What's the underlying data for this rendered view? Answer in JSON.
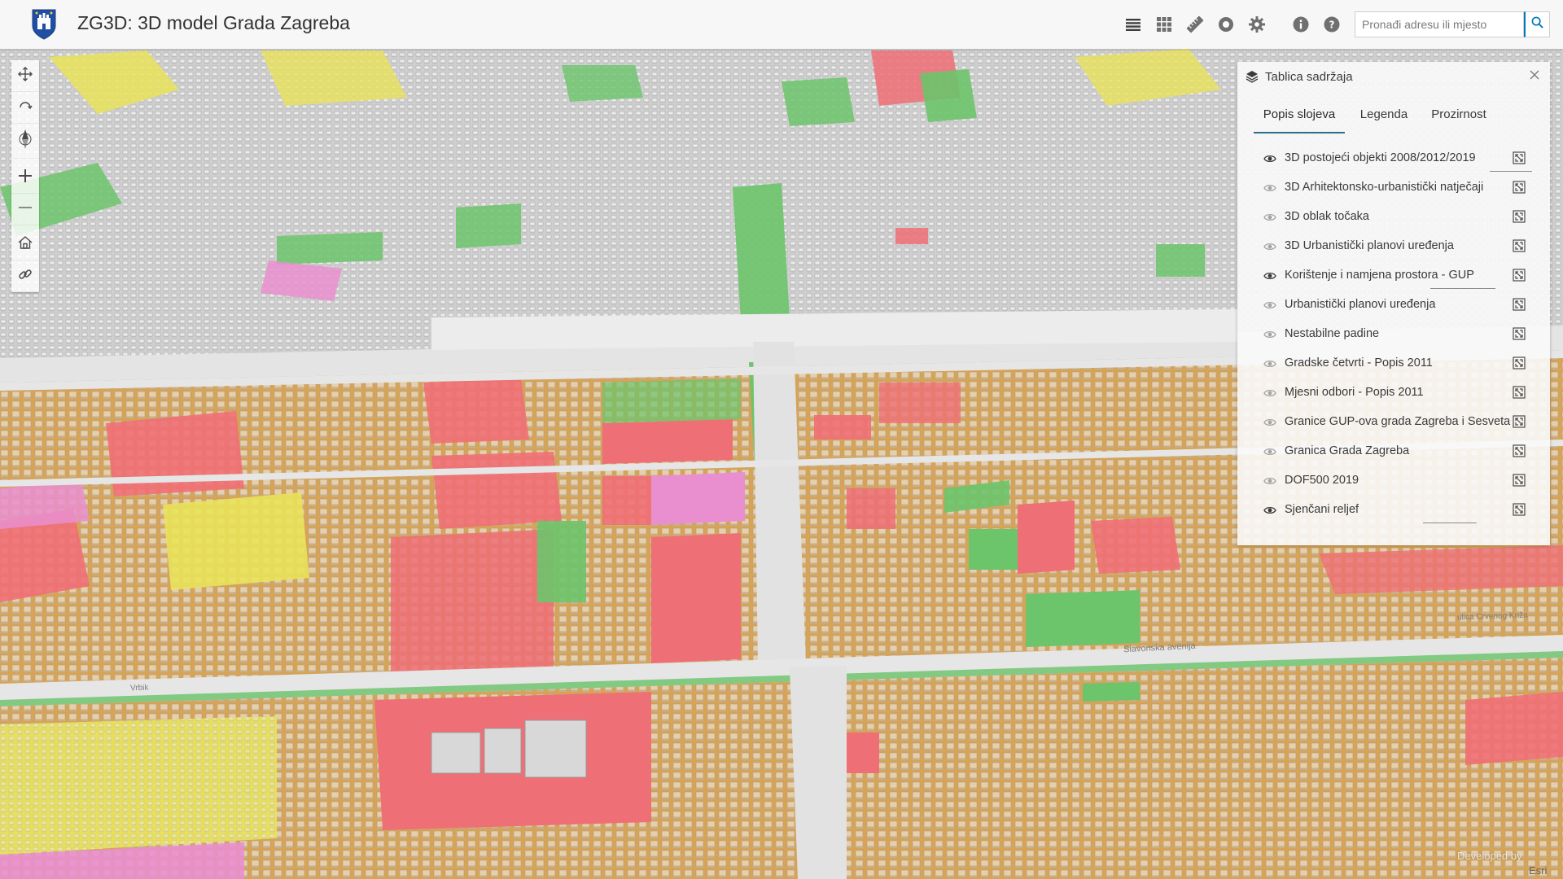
{
  "app": {
    "title": "ZG3D: 3D model Grada Zagreba"
  },
  "header_tools": [
    {
      "name": "layer-list-icon"
    },
    {
      "name": "basemap-gallery-icon"
    },
    {
      "name": "measure-icon"
    },
    {
      "name": "daylight-icon"
    },
    {
      "name": "settings-icon"
    },
    {
      "name": "info-icon"
    },
    {
      "name": "help-icon"
    }
  ],
  "search": {
    "placeholder": "Pronađi adresu ili mjesto"
  },
  "map_tools": [
    {
      "name": "pan-icon"
    },
    {
      "name": "rotate-icon"
    },
    {
      "name": "compass-icon"
    },
    {
      "name": "zoom-in-icon"
    },
    {
      "name": "zoom-out-icon"
    },
    {
      "name": "home-icon"
    },
    {
      "name": "link-icon"
    }
  ],
  "toc": {
    "title": "Tablica sadržaja",
    "tabs": [
      {
        "label": "Popis slojeva",
        "active": true
      },
      {
        "label": "Legenda",
        "active": false
      },
      {
        "label": "Prozirnost",
        "active": false
      }
    ],
    "layers": [
      {
        "label": "3D postojeći objekti 2008/2012/2019",
        "visible": true
      },
      {
        "label": "3D Arhitektonsko-urbanistički natječaji",
        "visible": false
      },
      {
        "label": "3D oblak točaka",
        "visible": false
      },
      {
        "label": "3D Urbanistički planovi uređenja",
        "visible": false
      },
      {
        "label": "Korištenje i namjena prostora - GUP",
        "visible": true
      },
      {
        "label": "Urbanistički planovi uređenja",
        "visible": false
      },
      {
        "label": "Nestabilne padine",
        "visible": false
      },
      {
        "label": "Gradske četvrti - Popis 2011",
        "visible": false
      },
      {
        "label": "Mjesni odbori - Popis 2011",
        "visible": false
      },
      {
        "label": "Granice GUP-ova grada Zagreba i Sesveta",
        "visible": false
      },
      {
        "label": "Granica Grada Zagreba",
        "visible": false
      },
      {
        "label": "DOF500 2019",
        "visible": false
      },
      {
        "label": "Sjenčani reljef",
        "visible": true
      }
    ]
  },
  "map_labels": {
    "street_east": "ulica Crvenog Križa",
    "street_south": "Slavonska avenija",
    "street_west": "Vrbik"
  },
  "attribution": {
    "developed": "Developed by",
    "esri": "Esri"
  },
  "colors": {
    "accent": "#0079c1",
    "header_bg": "#fafafa",
    "zone_residential": "#d6a458",
    "zone_commercial": "#ef6f76",
    "zone_green": "#6cc46b",
    "zone_yellow": "#e9e25a",
    "zone_pink": "#e98fcf"
  }
}
